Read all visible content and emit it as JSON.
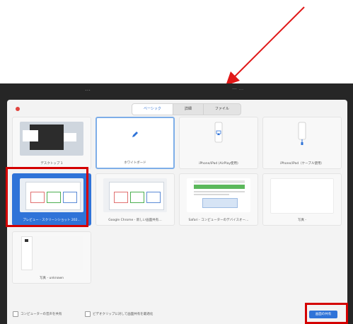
{
  "screen": {
    "title": "…",
    "sub": "— …"
  },
  "dialog": {
    "tabs": [
      {
        "label": "ベーシック",
        "active": true
      },
      {
        "label": "詳細",
        "active": false
      },
      {
        "label": "ファイル",
        "active": false
      }
    ],
    "tiles": [
      {
        "label": "デスクトップ 1",
        "icon": "desktop-thumbnail"
      },
      {
        "label": "ホワイトボード",
        "icon": "pencil-icon",
        "selected_outline": true
      },
      {
        "label": "iPhone/iPad (AirPlay使用)",
        "icon": "phone-airplay-icon"
      },
      {
        "label": "iPhone/iPad（ケーブル使用）",
        "icon": "phone-cable-icon"
      },
      {
        "label": "プレビュー - スクリーンショット 202...",
        "icon": "preview-window-thumbnail",
        "active": true
      },
      {
        "label": "Google Chrome - 新しい画面共有…",
        "icon": "chrome-window-thumbnail"
      },
      {
        "label": "Safari - コンピューターのデバイスオー…",
        "icon": "safari-window-thumbnail"
      },
      {
        "label": "写真 -",
        "icon": "blank-window"
      },
      {
        "label": "写真 - unknown",
        "icon": "photos-window-thumbnail"
      }
    ],
    "footer": {
      "option1": "コンピューターの音声を共有",
      "option2": "ビデオクリップに対して画面共有を最適化",
      "share_button": "画面の共有"
    }
  },
  "colors": {
    "accent": "#2f73d8",
    "annotation": "#d40000"
  }
}
